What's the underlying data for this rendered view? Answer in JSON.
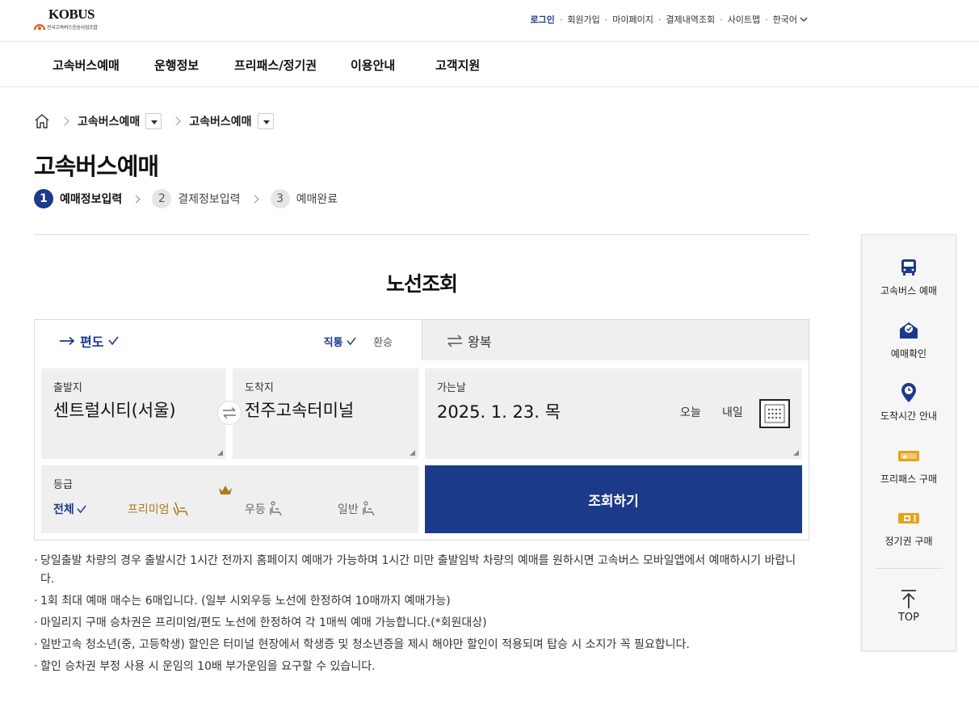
{
  "logo": {
    "brand": "KOBUS",
    "subtitle": "전국고속버스운송사업조합"
  },
  "utility": {
    "items": [
      "로그인",
      "회원가입",
      "마이페이지",
      "결제내역조회",
      "사이트맵"
    ],
    "language": "한국어"
  },
  "gnb": [
    "고속버스예매",
    "운행정보",
    "프리패스/정기권",
    "이용안내",
    "고객지원"
  ],
  "breadcrumb": [
    "고속버스예매",
    "고속버스예매"
  ],
  "page_title": "고속버스예매",
  "steps": [
    {
      "num": "1",
      "label": "예매정보입력"
    },
    {
      "num": "2",
      "label": "결제정보입력"
    },
    {
      "num": "3",
      "label": "예매완료"
    }
  ],
  "section_title": "노선조회",
  "trip": {
    "oneway": "편도",
    "roundtrip": "왕복",
    "direct": "직통",
    "transfer": "환승"
  },
  "departure": {
    "label": "출발지",
    "value": "센트럴시티(서울)"
  },
  "arrival": {
    "label": "도착지",
    "value": "전주고속터미널"
  },
  "date": {
    "label": "가는날",
    "value": "2025. 1. 23. 목",
    "today": "오늘",
    "tomorrow": "내일"
  },
  "grade": {
    "label": "등급",
    "options": [
      "전체",
      "프리미엄",
      "우등",
      "일반"
    ]
  },
  "search_button": "조회하기",
  "notices": [
    "당일출발 차량의 경우 출발시간 1시간 전까지 홈페이지 예매가 가능하며 1시간 미만 출발임박 차량의 예매를 원하시면 고속버스 모바일앱에서 예매하시기 바랍니다.",
    "1회 최대 예매 매수는 6매입니다. (일부 시외우등 노선에 한정하여 10매까지 예매가능)",
    "마일리지 구매 승차권은 프리미엄/편도 노선에 한정하여 각 1매씩 예매 가능합니다.(*회원대상)",
    "일반고속 청소년(중, 고등학생) 할인은 터미널 현장에서 학생증 및 청소년증을 제시 해야만 할인이 적용되며 탑승 시 소지가 꼭 필요합니다.",
    "할인 승차권 부정 사용 시 운임의 10배 부가운임을 요구할 수 있습니다."
  ],
  "quick_menu": [
    {
      "label": "고속버스 예매",
      "icon": "bus-icon"
    },
    {
      "label": "예매확인",
      "icon": "ticket-check-icon"
    },
    {
      "label": "도착시간 안내",
      "icon": "location-clock-icon"
    },
    {
      "label": "프리패스 구매",
      "icon": "freepass-ticket-icon"
    },
    {
      "label": "정기권 구매",
      "icon": "season-ticket-icon"
    }
  ],
  "top_button": "TOP",
  "colors": {
    "primary": "#1c3a8a",
    "premium": "#b07a18",
    "panel": "#efefef"
  }
}
